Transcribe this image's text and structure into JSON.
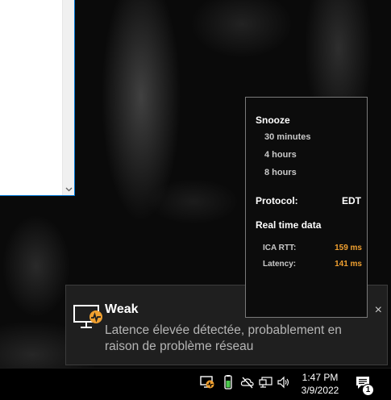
{
  "toast": {
    "title": "Weak",
    "body": "Latence élevée détectée, probablement en raison de problème réseau",
    "close": "×",
    "icon": "monitor-signal-warning-icon",
    "accent": "#f0a030"
  },
  "popup": {
    "snooze_header": "Snooze",
    "snooze_options": [
      "30 minutes",
      "4 hours",
      "8 hours"
    ],
    "protocol_label": "Protocol:",
    "protocol_value": "EDT",
    "realtime_header": "Real time data",
    "ica_rtt_label": "ICA RTT:",
    "ica_rtt_value": "159 ms",
    "latency_label": "Latency:",
    "latency_value": "141 ms"
  },
  "window": {
    "scroll_down": "⌄"
  },
  "taskbar": {
    "time": "1:47 PM",
    "date": "3/9/2022",
    "notification_count": "1",
    "tray_icons": [
      "citrix-hdx-icon",
      "battery-icon",
      "cloud-offline-icon",
      "network-icon",
      "volume-icon"
    ]
  }
}
